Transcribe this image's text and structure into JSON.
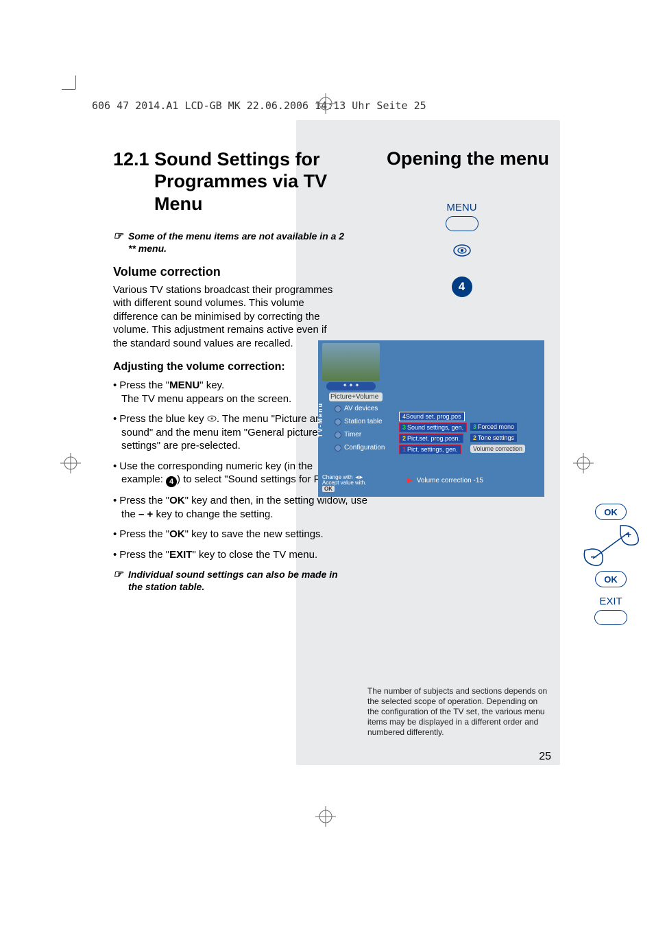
{
  "header_line": "606 47 2014.A1 LCD-GB MK  22.06.2006  14:13 Uhr  Seite 25",
  "title": {
    "number": "12.1",
    "line1": "Sound Settings for",
    "line2": "Programmes via TV Menu"
  },
  "opening_title": "Opening the menu",
  "note1": "Some of the menu items are not available in a 2 ** menu.",
  "note_icon": "☞",
  "subhead_vol": "Volume correction",
  "para_vol": "Various TV stations broadcast their programmes with different sound volumes. This volume difference can be minimised by correcting the volume. This adjustment remains active even if the standard sound values are recalled.",
  "subhead_adjust": "Adjusting the volume correction:",
  "bullets": [
    {
      "pre": "Press the \"",
      "bold": "MENU",
      "post": "\" key.",
      "line2": "The TV menu appears on the screen."
    },
    {
      "text": "Press the blue key ",
      "icon": "blue",
      "post": ". The menu \"Picture and sound\" and the menu item \"General picture settings\" are pre-selected."
    },
    {
      "text": "Use the corresponding numeric key (in the example: ",
      "badge": "4",
      "post": ") to select \"Sound settings for Pr.\"."
    },
    {
      "pre": "Press the \"",
      "bold": "OK",
      "post": "\" key and then, in the setting widow, use the ",
      "bold2": "– +",
      "post2": " key to change the setting."
    },
    {
      "pre": "Press the \"",
      "bold": "OK",
      "post": "\" key to save the new settings."
    },
    {
      "pre": "Press the \"",
      "bold": "EXIT",
      "post": "\" key to close the TV menu."
    }
  ],
  "note2": "Individual sound settings can also be made in the station table.",
  "right": {
    "menu_label": "MENU",
    "step_badge": "4"
  },
  "tvmenu": {
    "side_label": "TV-Menu",
    "stars": "✦ ✦ ✦",
    "items": [
      "Picture+Volume",
      "AV devices",
      "Station table",
      "Timer",
      "Configuration"
    ],
    "sub1": [
      {
        "num": "4",
        "cls": "numred",
        "label": "Sound set. prog.pos"
      },
      {
        "num": "3",
        "cls": "numgrn",
        "label": "Sound settings, gen."
      },
      {
        "num": "2",
        "cls": "numyel",
        "label": "Pict.set. prog.posn."
      },
      {
        "num": "1",
        "cls": "numred",
        "label": "Pict. settings, gen."
      }
    ],
    "sub2": [
      {
        "num": "3",
        "cls": "numgrn",
        "label": "Forced mono"
      },
      {
        "num": "2",
        "cls": "numyel",
        "label": "Tone settings"
      },
      {
        "label": "Volume correction",
        "highlight": true
      }
    ],
    "footer_lines": [
      "Change with",
      "Accept value with."
    ],
    "footer_ok": "OK",
    "status": "Volume correction   -15"
  },
  "ok_block": {
    "ok": "OK",
    "plus": "+",
    "minus": "–",
    "exit": "EXIT"
  },
  "gray_text": "The number of subjects and sections depends on the selected scope of operation. Depending on the configuration of the TV set, the various menu items may be displayed in a different order and numbered differently.",
  "page": "25"
}
